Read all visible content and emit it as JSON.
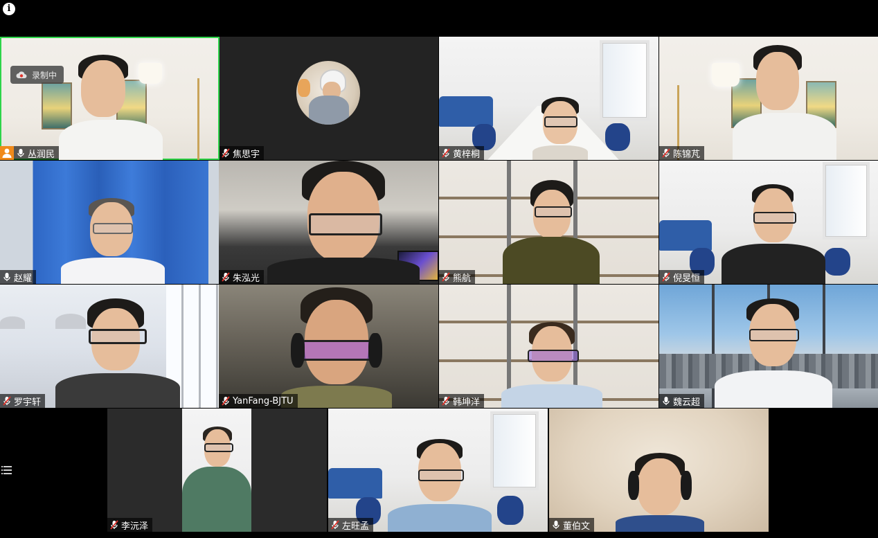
{
  "recording": {
    "label": "录制中"
  },
  "participants": [
    {
      "name": "丛润民",
      "mic": "on",
      "host": true,
      "active": true
    },
    {
      "name": "焦思宇",
      "mic": "muted",
      "avatar": true
    },
    {
      "name": "黄梓桐",
      "mic": "muted"
    },
    {
      "name": "陈锦芃",
      "mic": "muted"
    },
    {
      "name": "赵耀",
      "mic": "on"
    },
    {
      "name": "朱泓光",
      "mic": "muted"
    },
    {
      "name": "熊航",
      "mic": "muted"
    },
    {
      "name": "倪旻恒",
      "mic": "muted"
    },
    {
      "name": "罗宇轩",
      "mic": "muted"
    },
    {
      "name": "YanFang-BJTU",
      "mic": "muted"
    },
    {
      "name": "韩坤洋",
      "mic": "muted"
    },
    {
      "name": "魏云超",
      "mic": "on"
    },
    {
      "name": "李沅泽",
      "mic": "muted"
    },
    {
      "name": "左旺孟",
      "mic": "muted"
    },
    {
      "name": "董伯文",
      "mic": "on"
    }
  ],
  "icons": {
    "info": "info-icon",
    "menu": "list-menu-icon",
    "mic_on": "microphone-icon",
    "mic_muted": "microphone-muted-icon",
    "host": "host-person-icon",
    "recording": "cloud-recording-icon"
  },
  "colors": {
    "active_speaker": "#2ed44a",
    "host_badge": "#f08a1a",
    "muted_slash": "#e0342c"
  }
}
